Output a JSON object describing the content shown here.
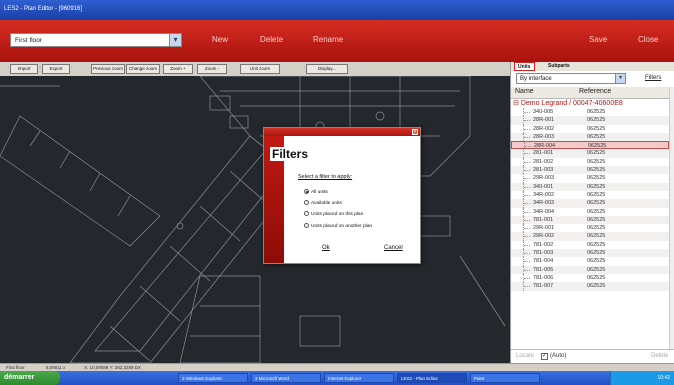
{
  "window": {
    "title": "LES2 - Plan Editor - [960916]"
  },
  "header": {
    "plan_select_value": "First floor",
    "new_label": "New",
    "delete_label": "Delete",
    "rename_label": "Rename",
    "save_label": "Save",
    "close_label": "Close"
  },
  "toolbar": {
    "buttons": [
      "Import",
      "Export",
      "Previous zoom",
      "Change zoom",
      "Zoom +",
      "Zoom -",
      "Unit zoom",
      "Display..."
    ]
  },
  "right_panel": {
    "tabs": [
      "Units",
      "Subparts"
    ],
    "filter_value": "By interface",
    "filters_link": "Filters",
    "col_name": "Name",
    "col_reference": "Reference",
    "group_label": "Demo Legrand / 00047-40600E8",
    "rows": [
      {
        "name": "340-005",
        "ref": "062525"
      },
      {
        "name": "28R-001",
        "ref": "062525"
      },
      {
        "name": "28R-002",
        "ref": "062525"
      },
      {
        "name": "28R-003",
        "ref": "062525"
      },
      {
        "name": "28R-004",
        "ref": "062525"
      },
      {
        "name": "281-001",
        "ref": "062525"
      },
      {
        "name": "281-002",
        "ref": "062525"
      },
      {
        "name": "281-003",
        "ref": "062525"
      },
      {
        "name": "29R-003",
        "ref": "062525"
      },
      {
        "name": "340-001",
        "ref": "062525"
      },
      {
        "name": "34R-002",
        "ref": "062525"
      },
      {
        "name": "34R-003",
        "ref": "062525"
      },
      {
        "name": "34R-004",
        "ref": "062525"
      },
      {
        "name": "781-001",
        "ref": "062525"
      },
      {
        "name": "29R-001",
        "ref": "062525"
      },
      {
        "name": "29R-002",
        "ref": "062525"
      },
      {
        "name": "781-002",
        "ref": "062525"
      },
      {
        "name": "781-003",
        "ref": "062525"
      },
      {
        "name": "781-004",
        "ref": "062525"
      },
      {
        "name": "781-005",
        "ref": "062525"
      },
      {
        "name": "781-006",
        "ref": "062525"
      },
      {
        "name": "781-007",
        "ref": "062525"
      }
    ],
    "locate_label": "Locate",
    "auto_label": "(Auto)",
    "delete_label": "Delete"
  },
  "dialog": {
    "title": "Filters",
    "prompt": "Select a filter to apply:",
    "options": [
      "All units",
      "Available units",
      "Units placed on this plan",
      "Units placed on another plan"
    ],
    "selected_option": 0,
    "ok_label": "Ok",
    "cancel_label": "Cancel"
  },
  "statusbar": {
    "plan": "First floor",
    "zoom": "8,09011 x",
    "coords": "X: 10,09089 Y: 282,3289 DX"
  },
  "taskbar": {
    "start_label": "démarrer",
    "tasks": [
      "3 Windows Explorer",
      "3 Microsoft Word",
      "Internet Explorer",
      "LES2 - Plan Editor",
      "Paint"
    ],
    "clock": "10:42"
  }
}
